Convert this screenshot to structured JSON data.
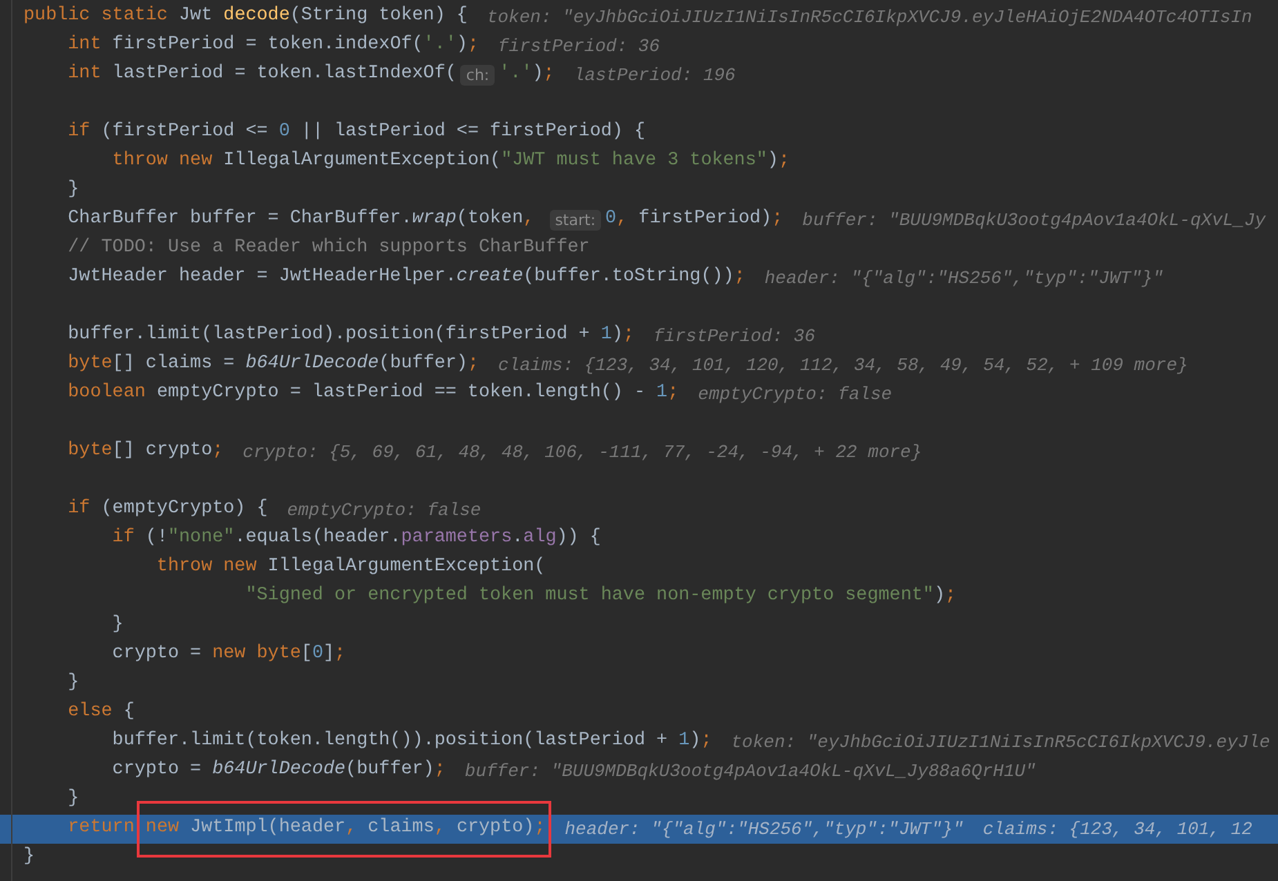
{
  "editor": {
    "lines": [
      {
        "current": false,
        "segments": [
          {
            "kind": "keyword",
            "text": "public static "
          },
          {
            "kind": "plain",
            "text": "Jwt "
          },
          {
            "kind": "decl",
            "text": "decode"
          },
          {
            "kind": "plain",
            "text": "(String token) {"
          }
        ],
        "hints": [
          "token: \"eyJhbGciOiJIUzI1NiIsInR5cCI6IkpXVCJ9.eyJleHAiOjE2NDA4OTc4OTIsIn"
        ]
      },
      {
        "current": false,
        "segments": [
          {
            "kind": "keyword",
            "text": "    int "
          },
          {
            "kind": "plain",
            "text": "firstPeriod = token.indexOf("
          },
          {
            "kind": "string",
            "text": "'.'"
          },
          {
            "kind": "plain",
            "text": ")"
          },
          {
            "kind": "keyword",
            "text": ";"
          }
        ],
        "hints": [
          "firstPeriod: 36"
        ]
      },
      {
        "current": false,
        "segments": [
          {
            "kind": "keyword",
            "text": "    int "
          },
          {
            "kind": "plain",
            "text": "lastPeriod = token.lastIndexOf("
          },
          {
            "kind": "param",
            "text": "ch:"
          },
          {
            "kind": "string",
            "text": "'.'"
          },
          {
            "kind": "plain",
            "text": ")"
          },
          {
            "kind": "keyword",
            "text": ";"
          }
        ],
        "hints": [
          "lastPeriod: 196"
        ]
      },
      {
        "current": false
      },
      {
        "current": false,
        "segments": [
          {
            "kind": "keyword",
            "text": "    if "
          },
          {
            "kind": "plain",
            "text": "(firstPeriod <= "
          },
          {
            "kind": "number",
            "text": "0"
          },
          {
            "kind": "plain",
            "text": " || lastPeriod <= firstPeriod) {"
          }
        ]
      },
      {
        "current": false,
        "segments": [
          {
            "kind": "keyword",
            "text": "        throw new "
          },
          {
            "kind": "plain",
            "text": "IllegalArgumentException("
          },
          {
            "kind": "string",
            "text": "\"JWT must have 3 tokens\""
          },
          {
            "kind": "plain",
            "text": ")"
          },
          {
            "kind": "keyword",
            "text": ";"
          }
        ]
      },
      {
        "current": false,
        "segments": [
          {
            "kind": "plain",
            "text": "    }"
          }
        ]
      },
      {
        "current": false,
        "segments": [
          {
            "kind": "plain",
            "text": "    CharBuffer buffer = CharBuffer."
          },
          {
            "kind": "call",
            "text": "wrap"
          },
          {
            "kind": "plain",
            "text": "(token"
          },
          {
            "kind": "keyword",
            "text": ", "
          },
          {
            "kind": "param",
            "text": "start:"
          },
          {
            "kind": "number",
            "text": "0"
          },
          {
            "kind": "keyword",
            "text": ", "
          },
          {
            "kind": "plain",
            "text": "firstPeriod)"
          },
          {
            "kind": "keyword",
            "text": ";"
          }
        ],
        "hints": [
          "buffer: \"BUU9MDBqkU3ootg4pAov1a4OkL-qXvL_Jy"
        ]
      },
      {
        "current": false,
        "segments": [
          {
            "kind": "comment",
            "text": "    // TODO: Use a Reader which supports CharBuffer"
          }
        ]
      },
      {
        "current": false,
        "segments": [
          {
            "kind": "plain",
            "text": "    JwtHeader header = JwtHeaderHelper."
          },
          {
            "kind": "call",
            "text": "create"
          },
          {
            "kind": "plain",
            "text": "(buffer.toString())"
          },
          {
            "kind": "keyword",
            "text": ";"
          }
        ],
        "hints": [
          "header: \"{\"alg\":\"HS256\",\"typ\":\"JWT\"}\""
        ]
      },
      {
        "current": false
      },
      {
        "current": false,
        "segments": [
          {
            "kind": "plain",
            "text": "    buffer.limit(lastPeriod).position(firstPeriod + "
          },
          {
            "kind": "number",
            "text": "1"
          },
          {
            "kind": "plain",
            "text": ")"
          },
          {
            "kind": "keyword",
            "text": ";"
          }
        ],
        "hints": [
          "firstPeriod: 36"
        ]
      },
      {
        "current": false,
        "segments": [
          {
            "kind": "keyword",
            "text": "    byte"
          },
          {
            "kind": "plain",
            "text": "[] claims = "
          },
          {
            "kind": "call",
            "text": "b64UrlDecode"
          },
          {
            "kind": "plain",
            "text": "(buffer)"
          },
          {
            "kind": "keyword",
            "text": ";"
          }
        ],
        "hints": [
          "claims: {123, 34, 101, 120, 112, 34, 58, 49, 54, 52, + 109 more}"
        ]
      },
      {
        "current": false,
        "segments": [
          {
            "kind": "keyword",
            "text": "    boolean "
          },
          {
            "kind": "plain",
            "text": "emptyCrypto = lastPeriod == token.length() - "
          },
          {
            "kind": "number",
            "text": "1"
          },
          {
            "kind": "keyword",
            "text": ";"
          }
        ],
        "hints": [
          "emptyCrypto: false"
        ]
      },
      {
        "current": false
      },
      {
        "current": false,
        "segments": [
          {
            "kind": "keyword",
            "text": "    byte"
          },
          {
            "kind": "plain",
            "text": "[] crypto"
          },
          {
            "kind": "keyword",
            "text": ";"
          }
        ],
        "hints": [
          "crypto: {5, 69, 61, 48, 48, 106, -111, 77, -24, -94, + 22 more}"
        ]
      },
      {
        "current": false
      },
      {
        "current": false,
        "segments": [
          {
            "kind": "keyword",
            "text": "    if "
          },
          {
            "kind": "plain",
            "text": "(emptyCrypto) {"
          }
        ],
        "hints": [
          "emptyCrypto: false"
        ]
      },
      {
        "current": false,
        "segments": [
          {
            "kind": "keyword",
            "text": "        if "
          },
          {
            "kind": "plain",
            "text": "(!"
          },
          {
            "kind": "string",
            "text": "\"none\""
          },
          {
            "kind": "plain",
            "text": ".equals(header."
          },
          {
            "kind": "field",
            "text": "parameters"
          },
          {
            "kind": "plain",
            "text": "."
          },
          {
            "kind": "field",
            "text": "alg"
          },
          {
            "kind": "plain",
            "text": ")) {"
          }
        ]
      },
      {
        "current": false,
        "segments": [
          {
            "kind": "keyword",
            "text": "            throw new "
          },
          {
            "kind": "plain",
            "text": "IllegalArgumentException("
          }
        ]
      },
      {
        "current": false,
        "segments": [
          {
            "kind": "string",
            "text": "                    \"Signed or encrypted token must have non-empty crypto segment\""
          },
          {
            "kind": "plain",
            "text": ")"
          },
          {
            "kind": "keyword",
            "text": ";"
          }
        ]
      },
      {
        "current": false,
        "segments": [
          {
            "kind": "plain",
            "text": "        }"
          }
        ]
      },
      {
        "current": false,
        "segments": [
          {
            "kind": "plain",
            "text": "        crypto = "
          },
          {
            "kind": "keyword",
            "text": "new byte"
          },
          {
            "kind": "plain",
            "text": "["
          },
          {
            "kind": "number",
            "text": "0"
          },
          {
            "kind": "plain",
            "text": "]"
          },
          {
            "kind": "keyword",
            "text": ";"
          }
        ]
      },
      {
        "current": false,
        "segments": [
          {
            "kind": "plain",
            "text": "    }"
          }
        ]
      },
      {
        "current": false,
        "segments": [
          {
            "kind": "keyword",
            "text": "    else "
          },
          {
            "kind": "plain",
            "text": "{"
          }
        ]
      },
      {
        "current": false,
        "segments": [
          {
            "kind": "plain",
            "text": "        buffer.limit(token.length()).position(lastPeriod + "
          },
          {
            "kind": "number",
            "text": "1"
          },
          {
            "kind": "plain",
            "text": ")"
          },
          {
            "kind": "keyword",
            "text": ";"
          }
        ],
        "hints": [
          "token: \"eyJhbGciOiJIUzI1NiIsInR5cCI6IkpXVCJ9.eyJle"
        ]
      },
      {
        "current": false,
        "segments": [
          {
            "kind": "plain",
            "text": "        crypto = "
          },
          {
            "kind": "call",
            "text": "b64UrlDecode"
          },
          {
            "kind": "plain",
            "text": "(buffer)"
          },
          {
            "kind": "keyword",
            "text": ";"
          }
        ],
        "hints": [
          "buffer: \"BUU9MDBqkU3ootg4pAov1a4OkL-qXvL_Jy88a6QrH1U\""
        ]
      },
      {
        "current": false,
        "segments": [
          {
            "kind": "plain",
            "text": "    }"
          }
        ]
      },
      {
        "current": true,
        "segments": [
          {
            "kind": "keyword",
            "text": "    return "
          }
        ],
        "framed": {
          "kind": "frame",
          "segments": [
            {
              "kind": "keyword",
              "text": "new "
            },
            {
              "kind": "plain",
              "text": "JwtImpl(header"
            },
            {
              "kind": "keyword",
              "text": ", "
            },
            {
              "kind": "plain",
              "text": "claims"
            },
            {
              "kind": "keyword",
              "text": ", "
            },
            {
              "kind": "plain",
              "text": "crypto)"
            },
            {
              "kind": "keyword",
              "text": ";"
            }
          ]
        },
        "hints": [
          "header: \"{\"alg\":\"HS256\",\"typ\":\"JWT\"}\"",
          "claims: {123, 34, 101, 12"
        ]
      },
      {
        "current": false,
        "segments": [
          {
            "kind": "plain",
            "text": "}"
          }
        ]
      }
    ]
  }
}
